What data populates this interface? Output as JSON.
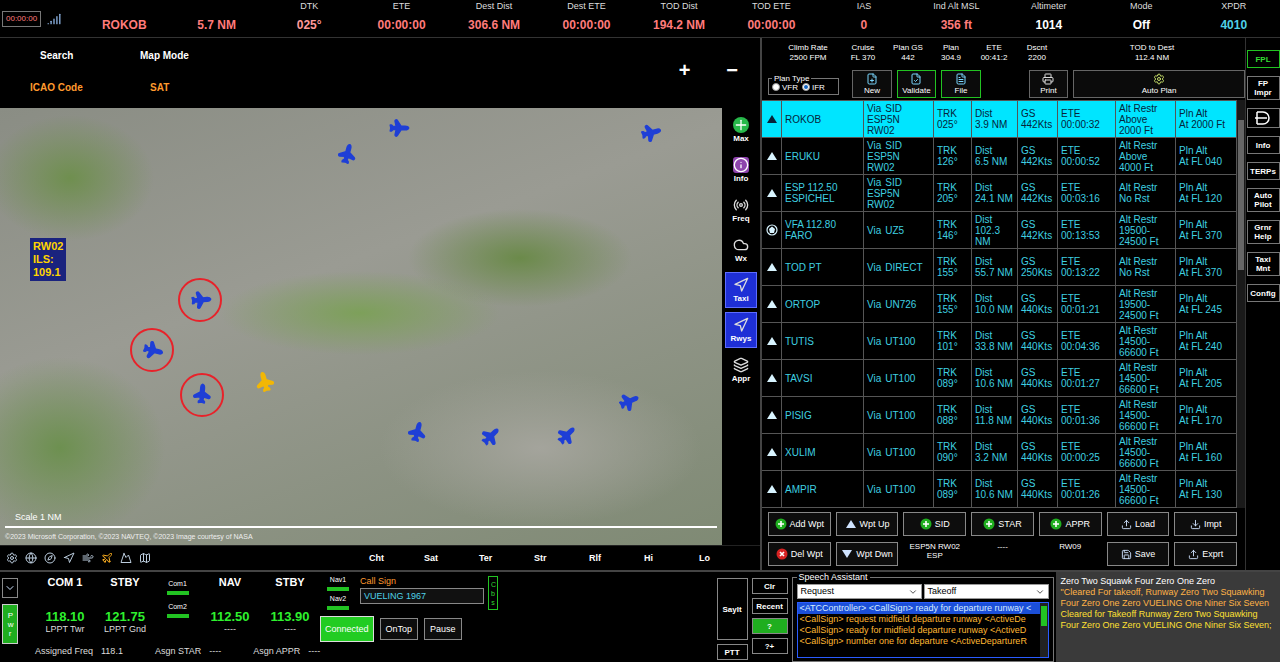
{
  "top_bar": {
    "clock": "00:00:00",
    "fields": [
      {
        "label": "",
        "value": "ROKOB",
        "color": "#ff7b7b"
      },
      {
        "label": "",
        "value": "5.7 NM",
        "color": "#ff7b7b"
      },
      {
        "label": "DTK",
        "value": "025°",
        "color": "#ff9a9a"
      },
      {
        "label": "ETE",
        "value": "00:00:00",
        "color": "#ff7b7b"
      },
      {
        "label": "Dest Dist",
        "value": "306.6 NM",
        "color": "#ff7b7b"
      },
      {
        "label": "Dest ETE",
        "value": "00:00:00",
        "color": "#ff7b7b"
      },
      {
        "label": "TOD Dist",
        "value": "194.2 NM",
        "color": "#ff7b7b"
      },
      {
        "label": "TOD ETE",
        "value": "00:00:00",
        "color": "#ff7b7b"
      },
      {
        "label": "IAS",
        "value": "0",
        "color": "#ff7b7b"
      },
      {
        "label": "Ind Alt MSL",
        "value": "356 ft",
        "color": "#ff7b7b"
      },
      {
        "label": "Altimeter",
        "value": "1014",
        "color": "#ffffff"
      },
      {
        "label": "Mode",
        "value": "Off",
        "color": "#ffffff"
      },
      {
        "label": "XPDR",
        "value": "4010",
        "color": "#4fd1e8"
      }
    ]
  },
  "map": {
    "header": {
      "search": "Search",
      "map_mode": "Map Mode",
      "icao": "ICAO Code",
      "sat": "SAT",
      "zoom_in": "+",
      "zoom_out": "−"
    },
    "tools": [
      {
        "label": "Max",
        "selected": false
      },
      {
        "label": "Info",
        "selected": false
      },
      {
        "label": "Freq",
        "selected": false
      },
      {
        "label": "Wx",
        "selected": false
      },
      {
        "label": "Taxi",
        "selected": true
      },
      {
        "label": "Rwys",
        "selected": true
      },
      {
        "label": "Appr",
        "selected": false
      }
    ],
    "runway_label": [
      "RW02",
      "ILS:",
      "109.1"
    ],
    "aircraft": [
      {
        "color": "#1f3fd6",
        "marked": false
      },
      {
        "color": "#1f3fd6",
        "marked": false
      },
      {
        "color": "#1f3fd6",
        "marked": false
      },
      {
        "color": "#1f3fd6",
        "marked": true
      },
      {
        "color": "#1f3fd6",
        "marked": true
      },
      {
        "color": "#1f3fd6",
        "marked": true
      },
      {
        "color": "#f2b705",
        "marked": false
      },
      {
        "color": "#1f3fd6",
        "marked": false
      },
      {
        "color": "#1f3fd6",
        "marked": false
      },
      {
        "color": "#1f3fd6",
        "marked": false
      },
      {
        "color": "#1f3fd6",
        "marked": false
      }
    ],
    "scale": "Scale 1 NM",
    "copyright": "©2023 Microsoft Corporation, ©2023 NAVTEQ, ©2023 Image courtesy of NASA",
    "layers": [
      "Cht",
      "Sat",
      "Ter",
      "Str",
      "Rlf",
      "Hi",
      "Lo"
    ]
  },
  "plan": {
    "summary": [
      {
        "label": "Climb Rate",
        "value": "2500 FPM"
      },
      {
        "label": "Cruise",
        "value": "FL 370"
      },
      {
        "label": "Plan GS",
        "value": "442"
      },
      {
        "label": "Plan",
        "value": "304.9"
      },
      {
        "label": "ETE",
        "value": "00:41:2"
      },
      {
        "label": "Dscnt",
        "value": "2200"
      },
      {
        "label": "TOD to Dest",
        "value": "112.4 NM"
      }
    ],
    "plan_type": {
      "label": "Plan Type",
      "options": [
        {
          "label": "VFR",
          "selected": false
        },
        {
          "label": "IFR",
          "selected": true
        }
      ]
    },
    "actions": [
      {
        "label": "New",
        "kind": "new",
        "highlighted": false
      },
      {
        "label": "Validate",
        "kind": "validate",
        "highlighted": true
      },
      {
        "label": "File",
        "kind": "file",
        "highlighted": true
      }
    ],
    "print": "Print",
    "auto_plan": "Auto Plan",
    "cell_labels": {
      "via": "Via",
      "trk": "TRK",
      "dist": "Dist",
      "gs": "GS",
      "ete": "ETE",
      "alt": "Alt Restr",
      "pln": "Pln Alt"
    },
    "waypoints": [
      {
        "name": "ROKOB",
        "sub": "",
        "kind": "fix",
        "via": "SID ESP5N RW02",
        "trk": "025°",
        "dist": "3.9 NM",
        "gs": "442Kts",
        "ete": "00:00:32",
        "alt": "Above 2000 Ft",
        "pln": "At 2000 Ft",
        "selected": true
      },
      {
        "name": "ERUKU",
        "sub": "",
        "kind": "fix",
        "via": "SID ESP5N RW02",
        "trk": "126°",
        "dist": "6.5 NM",
        "gs": "442Kts",
        "ete": "00:00:52",
        "alt": "Above 4000 Ft",
        "pln": "At FL 040",
        "selected": false
      },
      {
        "name": "ESP 112.50",
        "sub": "ESPICHEL",
        "kind": "fix",
        "via": "SID ESP5N RW02",
        "trk": "205°",
        "dist": "24.1 NM",
        "gs": "442Kts",
        "ete": "00:03:16",
        "alt": "No Rst",
        "pln": "At FL 120",
        "selected": false
      },
      {
        "name": "VFA 112.80",
        "sub": "FARO",
        "kind": "vor",
        "via": "UZ5",
        "trk": "146°",
        "dist": "102.3 NM",
        "gs": "442Kts",
        "ete": "00:13:53",
        "alt": "19500-24500 Ft",
        "pln": "At FL 370",
        "selected": false
      },
      {
        "name": "TOD PT",
        "sub": "",
        "kind": "fix",
        "via": "DIRECT",
        "trk": "155°",
        "dist": "55.7 NM",
        "gs": "250Kts",
        "ete": "00:13:22",
        "alt": "No Rst",
        "pln": "At FL 370",
        "selected": false
      },
      {
        "name": "ORTOP",
        "sub": "",
        "kind": "fix",
        "via": "UN726",
        "trk": "155°",
        "dist": "10.0 NM",
        "gs": "440Kts",
        "ete": "00:01:21",
        "alt": "19500-24500 Ft",
        "pln": "At FL 245",
        "selected": false
      },
      {
        "name": "TUTIS",
        "sub": "",
        "kind": "fix",
        "via": "UT100",
        "trk": "101°",
        "dist": "33.8 NM",
        "gs": "440Kts",
        "ete": "00:04:36",
        "alt": "14500-66600 Ft",
        "pln": "At FL 240",
        "selected": false
      },
      {
        "name": "TAVSI",
        "sub": "",
        "kind": "fix",
        "via": "UT100",
        "trk": "089°",
        "dist": "10.6 NM",
        "gs": "440Kts",
        "ete": "00:01:27",
        "alt": "14500-66600 Ft",
        "pln": "At FL 205",
        "selected": false
      },
      {
        "name": "PISIG",
        "sub": "",
        "kind": "fix",
        "via": "UT100",
        "trk": "088°",
        "dist": "11.8 NM",
        "gs": "440Kts",
        "ete": "00:01:36",
        "alt": "14500-66600 Ft",
        "pln": "At FL 170",
        "selected": false
      },
      {
        "name": "XULIM",
        "sub": "",
        "kind": "fix",
        "via": "UT100",
        "trk": "090°",
        "dist": "3.2 NM",
        "gs": "440Kts",
        "ete": "00:00:25",
        "alt": "14500-66600 Ft",
        "pln": "At FL 160",
        "selected": false
      },
      {
        "name": "AMPIR",
        "sub": "",
        "kind": "fix",
        "via": "UT100",
        "trk": "089°",
        "dist": "10.6 NM",
        "gs": "440Kts",
        "ete": "00:01:26",
        "alt": "14500-66600 Ft",
        "pln": "At FL 130",
        "selected": false
      }
    ],
    "buttons_top": [
      {
        "label": "Add Wpt",
        "kind": "add"
      },
      {
        "label": "Wpt Up",
        "kind": "up"
      },
      {
        "label": "SID",
        "kind": "add"
      },
      {
        "label": "STAR",
        "kind": "add"
      },
      {
        "label": "APPR",
        "kind": "add"
      },
      {
        "label": "Load",
        "kind": "load"
      },
      {
        "label": "Impt",
        "kind": "import"
      }
    ],
    "buttons_bottom": [
      {
        "label": "Del Wpt",
        "kind": "del"
      },
      {
        "label": "Wpt Dwn",
        "kind": "down"
      },
      {
        "label": "ESP5N RW02 ESP",
        "kind": "info"
      },
      {
        "label": "----",
        "kind": "info"
      },
      {
        "label": "RW09",
        "kind": "info"
      },
      {
        "label": "Save",
        "kind": "save"
      },
      {
        "label": "Exprt",
        "kind": "export"
      }
    ]
  },
  "side_menu": [
    {
      "label": "FPL",
      "kind": "text",
      "selected": true
    },
    {
      "label": "FP Impr",
      "kind": "text",
      "selected": false
    },
    {
      "label": "",
      "kind": "icon",
      "selected": false
    },
    {
      "label": "Info",
      "kind": "text",
      "selected": false
    },
    {
      "label": "TERPs",
      "kind": "text",
      "selected": false
    },
    {
      "label": "Auto Pilot",
      "kind": "text",
      "selected": false
    },
    {
      "label": "Grnr Help",
      "kind": "text",
      "selected": false
    },
    {
      "label": "Taxi Mnt",
      "kind": "text",
      "selected": false
    },
    {
      "label": "Config",
      "kind": "text",
      "selected": false
    }
  ],
  "radio": {
    "power": {
      "label": "Pwr",
      "on": true
    },
    "com": [
      {
        "title": "COM 1",
        "freq": "118.10",
        "station": "LPPT Twr"
      },
      {
        "title": "STBY",
        "freq": "121.75",
        "station": "LPPT Gnd"
      }
    ],
    "nav": [
      {
        "title": "NAV",
        "freq": "112.50",
        "station": "----"
      },
      {
        "title": "STBY",
        "freq": "113.90",
        "station": "----"
      }
    ],
    "com_switches": [
      "Com1",
      "Com2"
    ],
    "nav_switches": [
      "Nav1",
      "Nav2"
    ],
    "assigned": [
      {
        "label": "Assigned Freq",
        "value": "118.1"
      },
      {
        "label": "Asgn STAR",
        "value": "----"
      },
      {
        "label": "Asgn APPR",
        "value": "----"
      }
    ]
  },
  "call_sign": {
    "label": "Call Sign",
    "value": "VUELING 1967",
    "cbs": "Cbs",
    "connect": {
      "label": "Connected",
      "on": true
    },
    "buttons": [
      "OnTop",
      "Pause"
    ]
  },
  "controls": {
    "say": "SayIt",
    "ptt": "PTT",
    "clear": "Clr",
    "recent": "Recent",
    "help": "?",
    "help_plus": "?+"
  },
  "speech": {
    "title": "Speech Assistant",
    "selects": [
      "Request",
      "Takeoff"
    ],
    "phrases": [
      {
        "text": "<ATCController> <CallSign> ready for departure runway <",
        "selected": true
      },
      {
        "text": "<CallSign> request midfield departure runway <ActiveDe",
        "selected": false
      },
      {
        "text": "<CallSign> ready for midfield departure runway <ActiveD",
        "selected": false
      },
      {
        "text": "<CallSign> number one for departure <ActiveDepartureR",
        "selected": false
      }
    ]
  },
  "transcript": [
    {
      "text": "Zero Two Squawk Four Zero One Zero",
      "color": "#ffffff"
    },
    {
      "text": "\"Cleared For takeoff, Runway Zero Two Squawking Four Zero One Zero VUELING One Niner Six Seven",
      "color": "#ffb347"
    },
    {
      "text": "Cleared for Takeoff Runway Zero Two Squawking Four Zero One Zero VUELING One Niner Six Seven;",
      "color": "#ffe033"
    }
  ]
}
